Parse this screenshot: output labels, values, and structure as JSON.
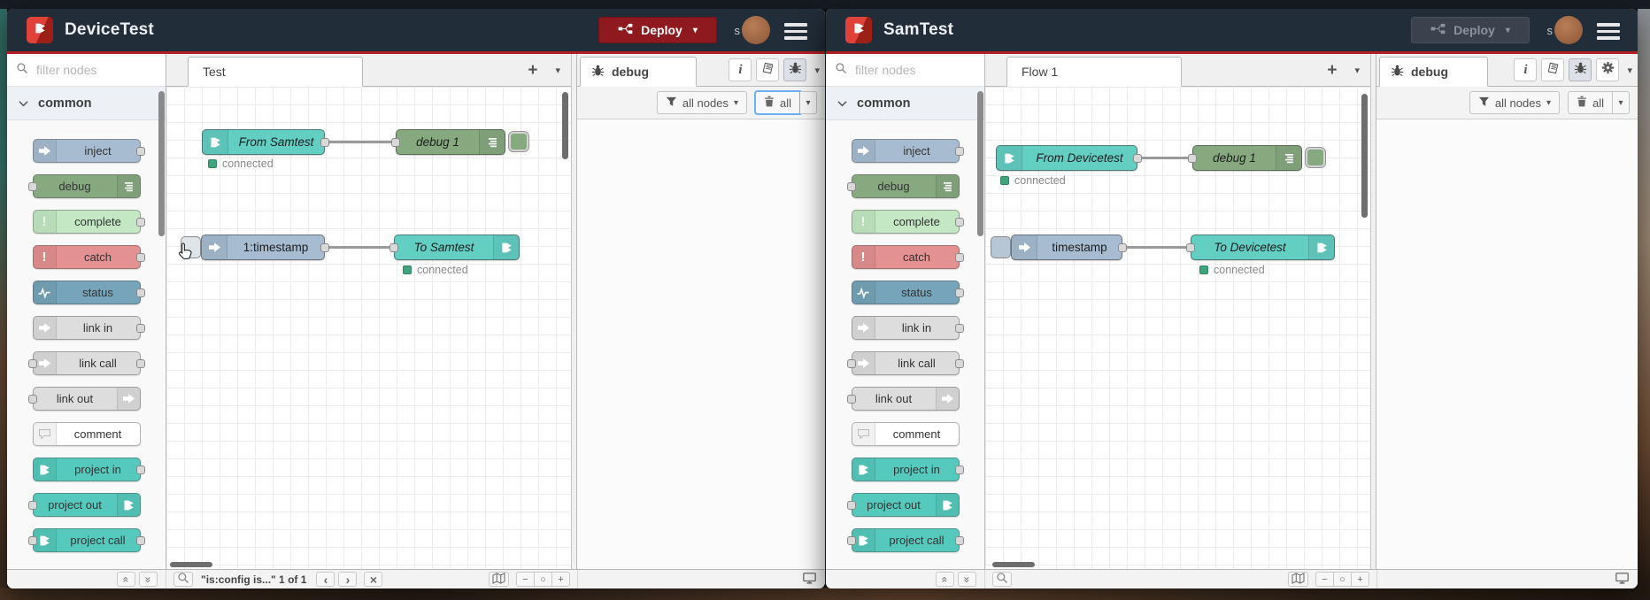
{
  "colors": {
    "header_bg": "#212d39",
    "accent_red": "#b12025",
    "deploy_red": "#8e1a20",
    "node_teal": "#63cfc3",
    "node_green": "#87a980",
    "node_inject": "#a7bcd0",
    "status_green": "#3fa47c"
  },
  "icons_map": {
    "caret-down": "▾",
    "zoom_out": "−",
    "zoom_reset": "○",
    "zoom_in": "+",
    "plus": "+",
    "close": "×",
    "prev": "‹",
    "next": "›",
    "collapse_up": "« rotated 90°",
    "collapse_down": "» rotated 90°"
  },
  "palette": {
    "filter_placeholder": "filter nodes",
    "category": "common",
    "items": [
      {
        "label": "inject",
        "color": "#a7bcd0",
        "icon": "arrow",
        "icon_side": "left",
        "ports": "right"
      },
      {
        "label": "debug",
        "color": "#87a980",
        "icon": "lines",
        "icon_side": "right",
        "ports": "left"
      },
      {
        "label": "complete",
        "color": "#c3e8c3",
        "icon": "excl-faded",
        "icon_side": "left",
        "ports": "right"
      },
      {
        "label": "catch",
        "color": "#e49191",
        "icon": "excl",
        "icon_side": "left",
        "ports": "right"
      },
      {
        "label": "status",
        "color": "#76a4ba",
        "icon": "heartbeat",
        "icon_side": "left",
        "ports": "right"
      },
      {
        "label": "link in",
        "color": "#dddddd",
        "icon": "arrow",
        "icon_side": "left",
        "ports": "right"
      },
      {
        "label": "link call",
        "color": "#dddddd",
        "icon": "arrow",
        "icon_side": "left",
        "ports": "both"
      },
      {
        "label": "link out",
        "color": "#dddddd",
        "icon": "arrow",
        "icon_side": "right",
        "ports": "left"
      },
      {
        "label": "comment",
        "color": "#ffffff",
        "icon": "bubble",
        "icon_side": "left",
        "ports": "none"
      },
      {
        "label": "project in",
        "color": "#56c9bd",
        "icon": "nrlogo",
        "icon_side": "left",
        "ports": "right"
      },
      {
        "label": "project out",
        "color": "#56c9bd",
        "icon": "nrlogo",
        "icon_side": "right",
        "ports": "left"
      },
      {
        "label": "project call",
        "color": "#56c9bd",
        "icon": "nrlogo",
        "icon_side": "left",
        "ports": "both"
      }
    ]
  },
  "left": {
    "title": "DeviceTest",
    "deploy": {
      "label": "Deploy",
      "state": "enabled"
    },
    "user": {
      "initial": "s"
    },
    "workspace": {
      "tab": "Test"
    },
    "flow": {
      "node_from": {
        "label": "From Samtest",
        "status": "connected"
      },
      "node_debug": {
        "label": "debug 1"
      },
      "node_inject": {
        "label": "1:timestamp"
      },
      "node_to": {
        "label": "To Samtest",
        "status": "connected"
      }
    },
    "debug_panel": {
      "tab": "debug",
      "filter_label": "all nodes",
      "clear_label": "all"
    },
    "footer": {
      "search_result": "\"is:config is...\" 1 of 1"
    }
  },
  "right": {
    "title": "SamTest",
    "deploy": {
      "label": "Deploy",
      "state": "disabled"
    },
    "user": {
      "initial": "s"
    },
    "workspace": {
      "tab": "Flow 1"
    },
    "flow": {
      "node_from": {
        "label": "From Devicetest",
        "status": "connected"
      },
      "node_debug": {
        "label": "debug 1"
      },
      "node_inject": {
        "label": "timestamp"
      },
      "node_to": {
        "label": "To Devicetest",
        "status": "connected"
      }
    },
    "debug_panel": {
      "tab": "debug",
      "filter_label": "all nodes",
      "clear_label": "all"
    },
    "footer": {
      "search_result": ""
    }
  }
}
